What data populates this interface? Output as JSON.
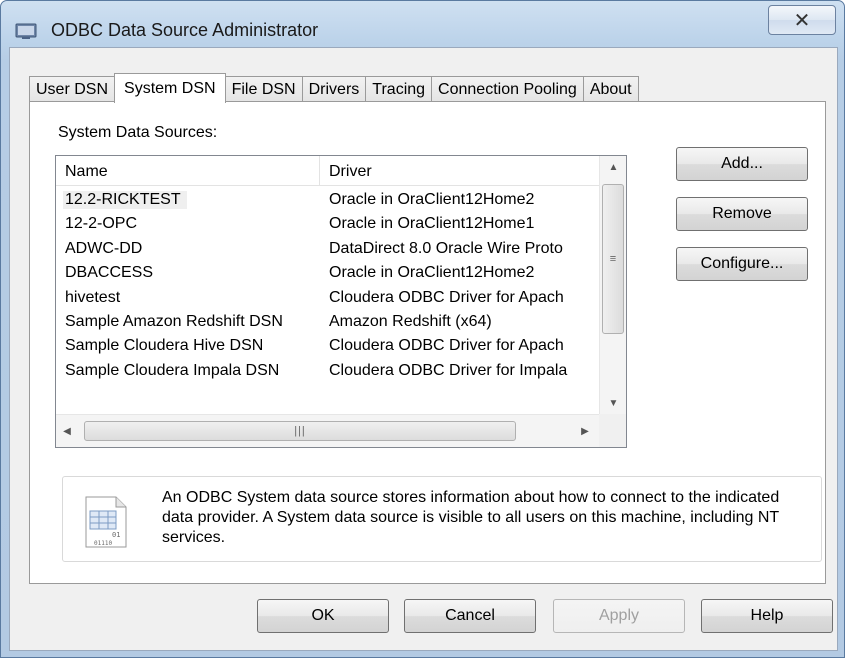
{
  "window": {
    "title": "ODBC Data Source Administrator",
    "close_glyph": "✕"
  },
  "tabs": [
    {
      "label": "User DSN",
      "active": false
    },
    {
      "label": "System DSN",
      "active": true
    },
    {
      "label": "File DSN",
      "active": false
    },
    {
      "label": "Drivers",
      "active": false
    },
    {
      "label": "Tracing",
      "active": false
    },
    {
      "label": "Connection Pooling",
      "active": false
    },
    {
      "label": "About",
      "active": false
    }
  ],
  "panel": {
    "group_label": "System Data Sources:",
    "columns": {
      "name": "Name",
      "driver": "Driver"
    },
    "rows": [
      {
        "name": "12.2-RICKTEST",
        "driver": "Oracle in OraClient12Home2",
        "selected": true
      },
      {
        "name": "12-2-OPC",
        "driver": "Oracle in OraClient12Home1"
      },
      {
        "name": "ADWC-DD",
        "driver": "DataDirect 8.0 Oracle Wire Proto"
      },
      {
        "name": "DBACCESS",
        "driver": "Oracle in OraClient12Home2"
      },
      {
        "name": "hivetest",
        "driver": "Cloudera ODBC Driver for Apach"
      },
      {
        "name": "Sample Amazon Redshift DSN",
        "driver": "Amazon Redshift (x64)"
      },
      {
        "name": "Sample Cloudera Hive DSN",
        "driver": "Cloudera ODBC Driver for Apach"
      },
      {
        "name": "Sample Cloudera Impala DSN",
        "driver": "Cloudera ODBC Driver for Impala"
      }
    ],
    "side_buttons": {
      "add": "Add...",
      "remove": "Remove",
      "configure": "Configure..."
    },
    "info_text": "An ODBC System data source stores information about how to connect to the indicated data provider.  A System data source is visible to all users on this machine, including NT services."
  },
  "footer": {
    "ok": "OK",
    "cancel": "Cancel",
    "apply": "Apply",
    "help": "Help"
  }
}
